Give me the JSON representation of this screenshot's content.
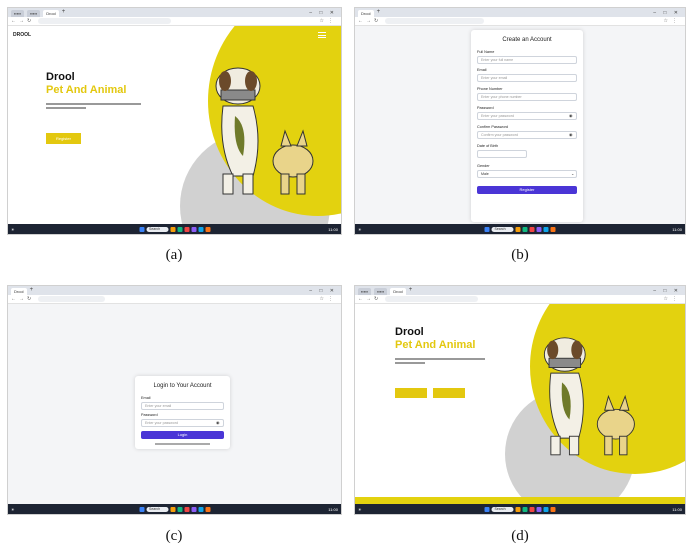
{
  "captions": [
    "(a)",
    "(b)",
    "(c)",
    "(d)"
  ],
  "colors": {
    "brand_yellow": "#e3c80f",
    "purple": "#4a35d6",
    "taskbar": "#1d2433"
  },
  "icons": [
    "dog-illustration",
    "search-icon",
    "eye-icon",
    "windows-start-icon",
    "hamburger-menu-icon"
  ],
  "taskbar": {
    "search_label": "Search",
    "time": "11:00"
  },
  "panel_a": {
    "tab_label": "Drool",
    "logo": "DROOL",
    "title": "Drool",
    "subtitle": "Pet And Animal",
    "button": "Register"
  },
  "panel_b": {
    "tab_label": "Drool",
    "form_title": "Create an Account",
    "fields": [
      {
        "label": "Full Name",
        "placeholder": "Enter your full name"
      },
      {
        "label": "Email",
        "placeholder": "Enter your email"
      },
      {
        "label": "Phone Number",
        "placeholder": "Enter your phone number"
      },
      {
        "label": "Password",
        "placeholder": "Enter your password"
      },
      {
        "label": "Confirm Password",
        "placeholder": "Confirm your password"
      },
      {
        "label": "Date of Birth",
        "placeholder": ""
      },
      {
        "label": "Gender",
        "placeholder": "Male"
      }
    ],
    "button": "Register"
  },
  "panel_c": {
    "tab_label": "Drool",
    "form_title": "Login to Your Account",
    "fields": [
      {
        "label": "Email",
        "placeholder": "Enter your email"
      },
      {
        "label": "Password",
        "placeholder": "Enter your password"
      }
    ],
    "button": "Login"
  },
  "panel_d": {
    "tab_label": "Drool",
    "title": "Drool",
    "subtitle": "Pet And Animal"
  }
}
